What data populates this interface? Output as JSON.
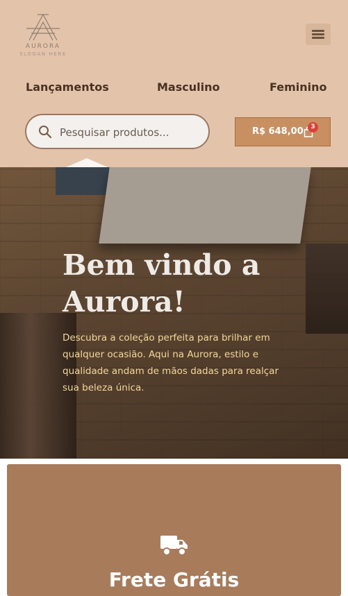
{
  "brand": {
    "name": "AURORA",
    "slogan": "SLOGAN HERE"
  },
  "nav": {
    "items": [
      "Lançamentos",
      "Masculino",
      "Feminino"
    ]
  },
  "search": {
    "placeholder": "Pesquisar produtos..."
  },
  "cart": {
    "total": "R$ 648,00",
    "count": "3"
  },
  "hero": {
    "title": "Bem vindo a Aurora!",
    "text": "Descubra a coleção perfeita para brilhar em qualquer ocasião. Aqui na Aurora, estilo e qualidade andam de mãos dadas para realçar sua beleza única."
  },
  "feature": {
    "title": "Frete Grátis",
    "icon": "truck-icon"
  },
  "colors": {
    "header_bg": "#e3c4aa",
    "accent": "#c88f60",
    "feature_bg": "#a87c5a",
    "hero_text": "#f1d79a"
  }
}
